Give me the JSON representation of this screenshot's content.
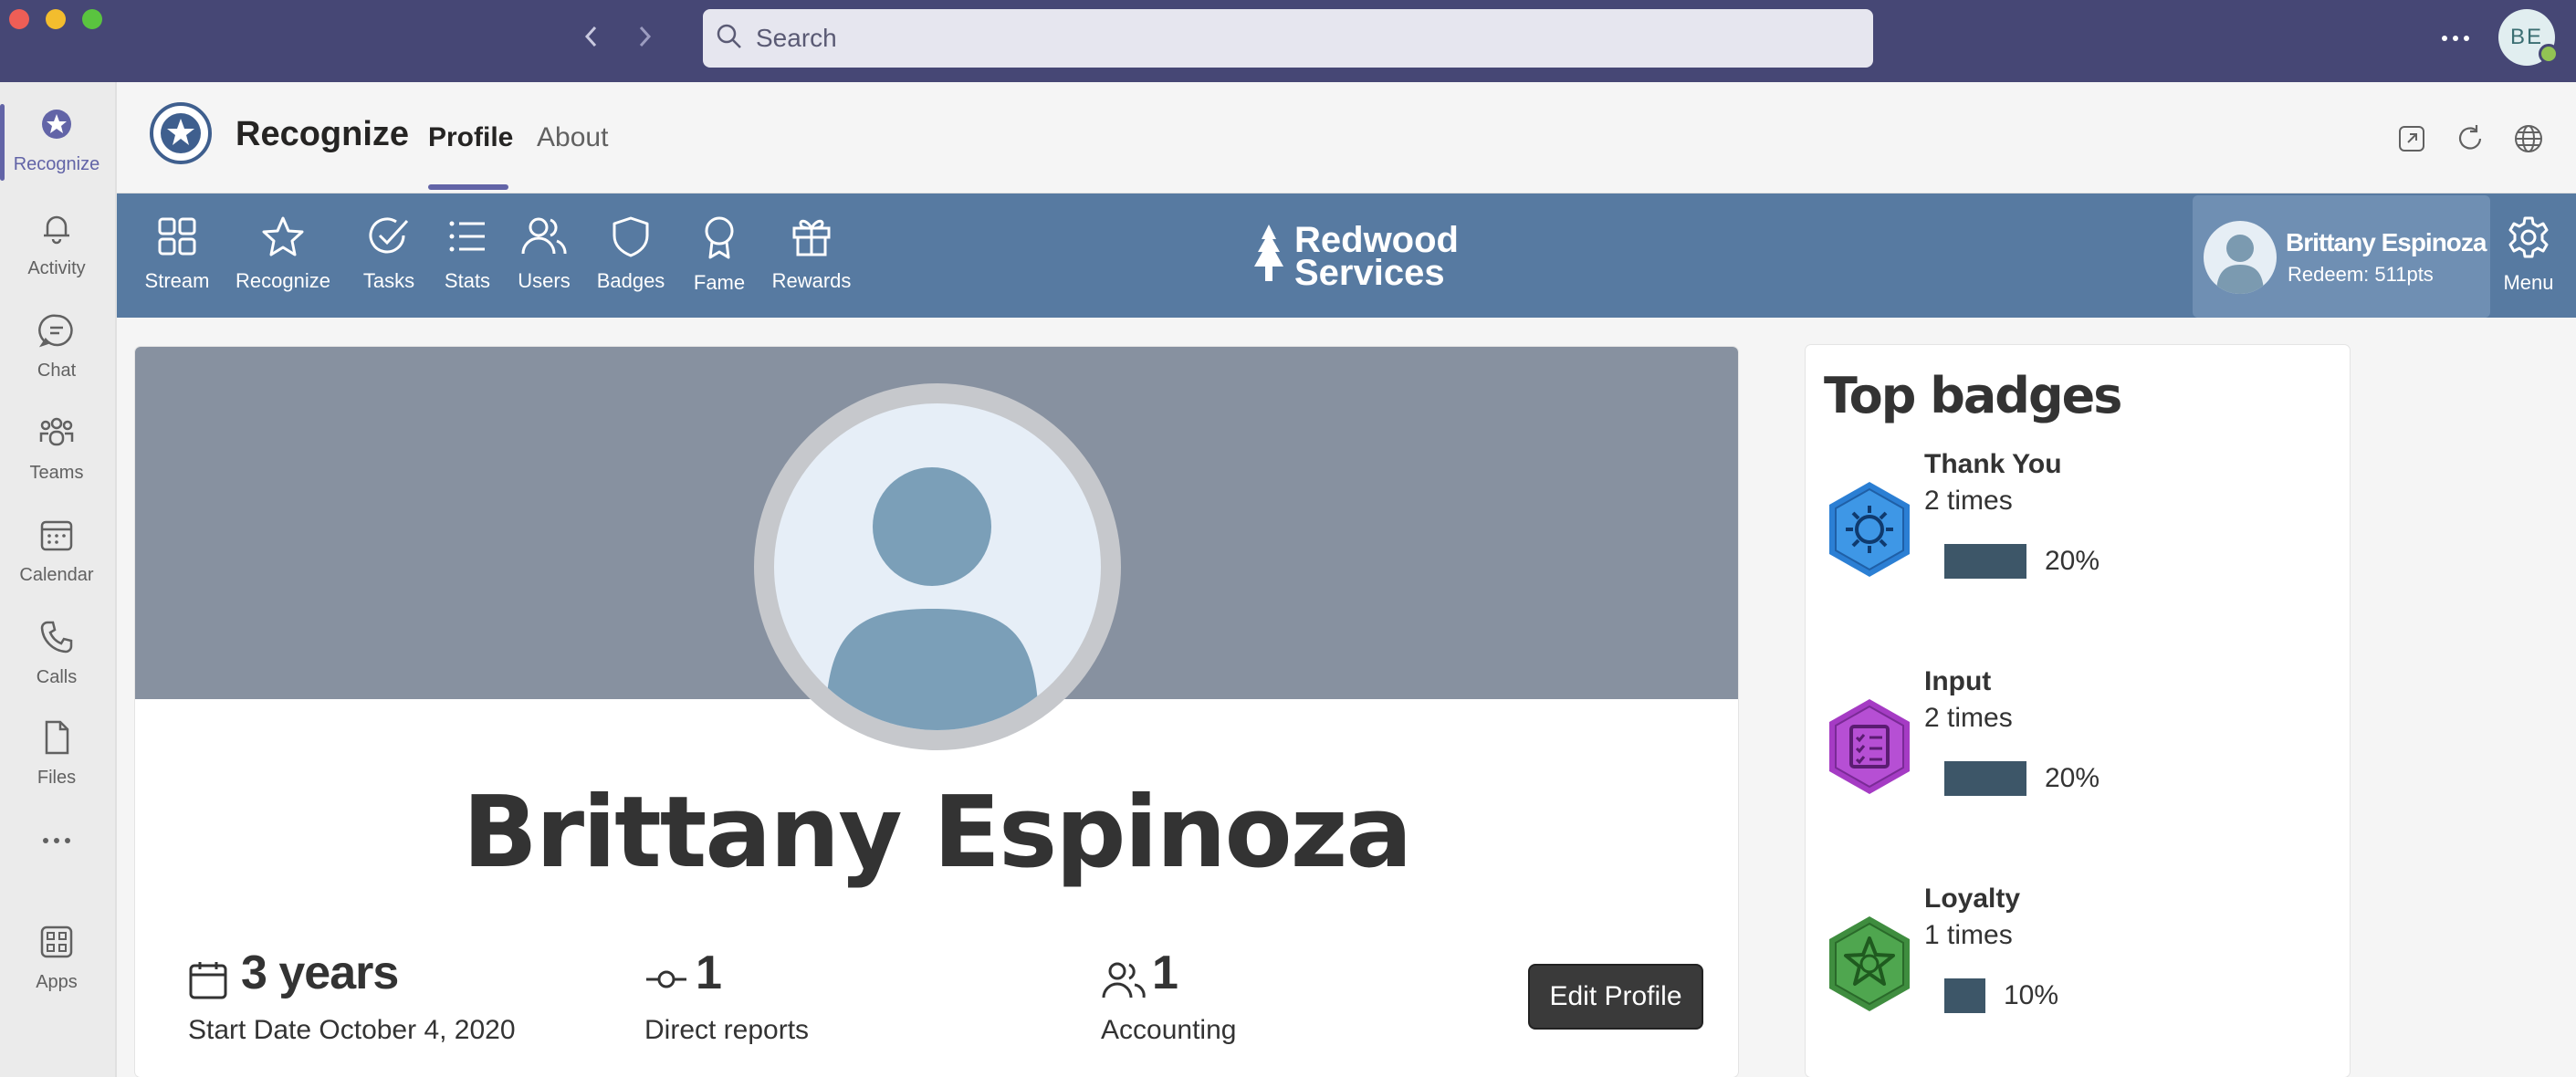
{
  "titlebar": {
    "search_placeholder": "Search",
    "user_initials": "BE",
    "accent": "#464775"
  },
  "rail": {
    "items": [
      {
        "label": "Recognize",
        "icon": "recognize-icon",
        "active": true
      },
      {
        "label": "Activity",
        "icon": "bell-icon"
      },
      {
        "label": "Chat",
        "icon": "chat-icon"
      },
      {
        "label": "Teams",
        "icon": "teams-icon"
      },
      {
        "label": "Calendar",
        "icon": "calendar-icon"
      },
      {
        "label": "Calls",
        "icon": "phone-icon"
      },
      {
        "label": "Files",
        "icon": "file-icon"
      },
      {
        "label": "",
        "icon": "more-icon"
      },
      {
        "label": "Apps",
        "icon": "apps-icon"
      }
    ]
  },
  "app_header": {
    "title": "Recognize",
    "tabs": [
      {
        "label": "Profile",
        "active": true
      },
      {
        "label": "About"
      }
    ]
  },
  "toolbar": {
    "color": "#577aa1",
    "items": [
      {
        "label": "Stream",
        "icon": "grid-icon"
      },
      {
        "label": "Recognize",
        "icon": "star-icon"
      },
      {
        "label": "Tasks",
        "icon": "check-circle-icon"
      },
      {
        "label": "Stats",
        "icon": "list-icon"
      },
      {
        "label": "Users",
        "icon": "users-icon"
      },
      {
        "label": "Badges",
        "icon": "shield-icon"
      },
      {
        "label": "Fame",
        "icon": "award-icon"
      },
      {
        "label": "Rewards",
        "icon": "gift-icon"
      }
    ],
    "brand_line1": "Redwood",
    "brand_line2": "Services",
    "user_name": "Brittany Espinoza",
    "user_points": "Redeem: 511pts",
    "menu_label": "Menu"
  },
  "profile": {
    "name": "Brittany Espinoza",
    "tenure": "3 years",
    "start_date": "Start Date October 4, 2020",
    "direct_reports_count": "1",
    "direct_reports_label": "Direct reports",
    "team_count": "1",
    "team_label": "Accounting",
    "edit_button": "Edit Profile"
  },
  "top_badges": {
    "title": "Top badges",
    "badges": [
      {
        "name": "Thank You",
        "count": "2 times",
        "percent": "20%",
        "fraction": 0.2,
        "color": "#2b7fd4",
        "icon": "sun-icon"
      },
      {
        "name": "Input",
        "count": "2 times",
        "percent": "20%",
        "fraction": 0.2,
        "color": "#a53bc4",
        "icon": "checklist-icon"
      },
      {
        "name": "Loyalty",
        "count": "1 times",
        "percent": "10%",
        "fraction": 0.1,
        "color": "#3f8d3f",
        "icon": "star-badge-icon"
      }
    ]
  }
}
